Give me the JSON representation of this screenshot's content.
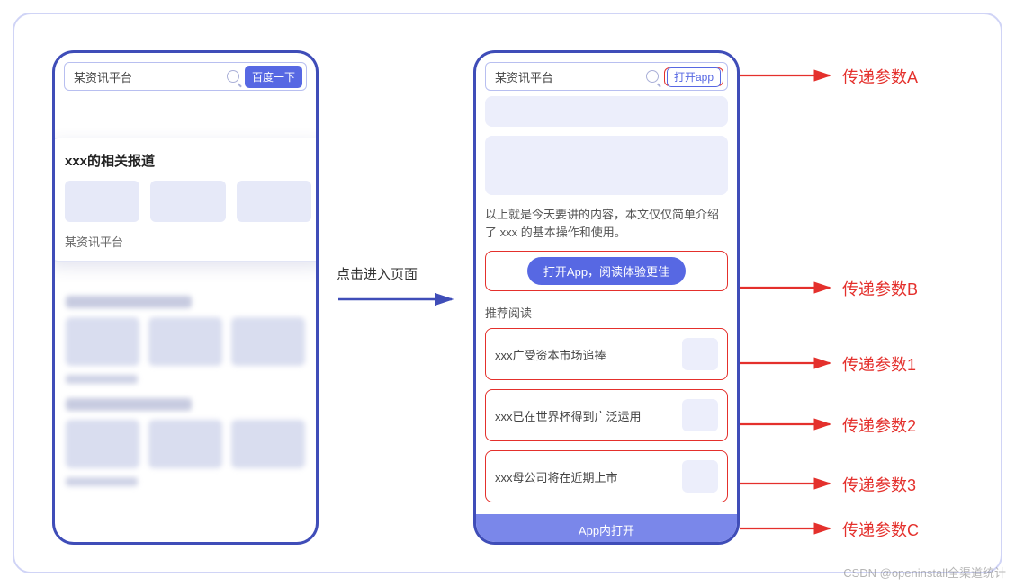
{
  "colors": {
    "accent": "#5768e3",
    "highlight": "#e4302c",
    "frame": "#3f4db8"
  },
  "left_phone": {
    "platform": "某资讯平台",
    "search_button": "百度一下",
    "card": {
      "title": "xxx的相关报道",
      "source": "某资讯平台"
    }
  },
  "transition_label": "点击进入页面",
  "right_phone": {
    "platform": "某资讯平台",
    "open_app_button": "打开app",
    "body_text": "以上就是今天要讲的内容，本文仅仅简单介绍了 xxx 的基本操作和使用。",
    "read_better_button": "打开App，阅读体验更佳",
    "recommend_title": "推荐阅读",
    "recommend_items": [
      "xxx广受资本市场追捧",
      "xxx已在世界杯得到广泛运用",
      "xxx母公司将在近期上市"
    ],
    "bottom_button": "App内打开"
  },
  "annotations": {
    "a": "传递参数A",
    "b": "传递参数B",
    "c": "传递参数C",
    "n1": "传递参数1",
    "n2": "传递参数2",
    "n3": "传递参数3"
  },
  "watermark": "CSDN @openinstall全渠道统计"
}
